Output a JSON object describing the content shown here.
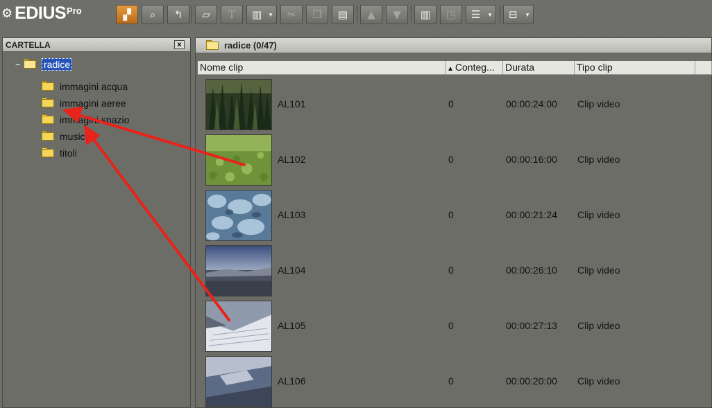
{
  "app": {
    "logo_text": "EDIUS",
    "logo_suffix": "Pro"
  },
  "toolbar": {
    "buttons": [
      {
        "name": "new-bin-button",
        "icon": "folder-stack-icon"
      },
      {
        "name": "search-clip-button",
        "icon": "search-icon"
      },
      {
        "name": "parent-folder-button",
        "icon": "up-arrow-icon"
      },
      {
        "name": "open-clip-button",
        "icon": "open-folder-icon"
      },
      {
        "name": "add-title-button",
        "icon": "title-icon"
      },
      {
        "name": "add-color-matte-button",
        "icon": "color-bars-icon"
      },
      {
        "name": "cut-button",
        "icon": "scissors-icon"
      },
      {
        "name": "copy-button",
        "icon": "copy-icon"
      },
      {
        "name": "paste-button",
        "icon": "paste-icon"
      },
      {
        "name": "show-in-player-button",
        "icon": "player-icon"
      },
      {
        "name": "add-to-timeline-button",
        "icon": "timeline-icon"
      },
      {
        "name": "delete-button",
        "icon": "trash-icon"
      },
      {
        "name": "properties-button",
        "icon": "properties-icon"
      },
      {
        "name": "view-mode-button",
        "icon": "list-view-icon"
      },
      {
        "name": "tools-button",
        "icon": "device-icon"
      }
    ]
  },
  "folder_panel": {
    "title": "CARTELLA",
    "close_glyph": "x",
    "tree": {
      "root": {
        "label": "radice",
        "toggle": "−"
      },
      "children": [
        {
          "label": "immagini acqua"
        },
        {
          "label": "immagini aeree"
        },
        {
          "label": "immagini spazio"
        },
        {
          "label": "musiche"
        },
        {
          "label": "titoli"
        }
      ]
    }
  },
  "bin_panel": {
    "title": "radice (0/47)",
    "columns": [
      "Nome clip",
      "Conteg...",
      "Durata",
      "Tipo clip"
    ],
    "sorted_column": "Nome clip",
    "clips": [
      {
        "name": "AL101",
        "count": "0",
        "duration": "00:00:24:00",
        "type": "Clip video",
        "thumb": "forest"
      },
      {
        "name": "AL102",
        "count": "0",
        "duration": "00:00:16:00",
        "type": "Clip video",
        "thumb": "meadow"
      },
      {
        "name": "AL103",
        "count": "0",
        "duration": "00:00:21:24",
        "type": "Clip video",
        "thumb": "glacier"
      },
      {
        "name": "AL104",
        "count": "0",
        "duration": "00:00:26:10",
        "type": "Clip video",
        "thumb": "valley"
      },
      {
        "name": "AL105",
        "count": "0",
        "duration": "00:00:27:13",
        "type": "Clip video",
        "thumb": "snow-slope"
      },
      {
        "name": "AL106",
        "count": "0",
        "duration": "00:00:20:00",
        "type": "Clip video",
        "thumb": "aerial-coast"
      }
    ]
  },
  "annotations": {
    "arrow_color": "#e8231c"
  }
}
